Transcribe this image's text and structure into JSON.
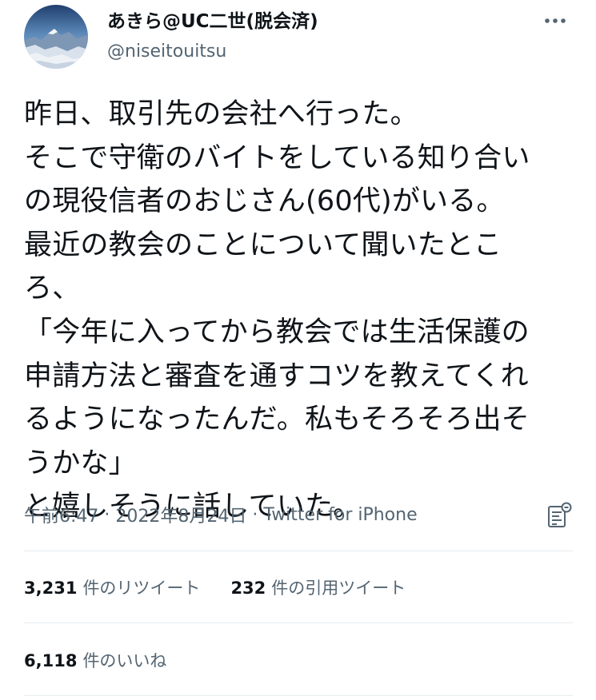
{
  "user": {
    "display_name": "あきら@UC二世(脱会済)",
    "handle": "@niseitouitsu",
    "avatar": "mountain-landscape-avatar"
  },
  "header": {
    "more_icon": "more-horizontal-icon"
  },
  "tweet": {
    "lines": [
      "昨日、取引先の会社へ行った。",
      "そこで守衛のバイトをしている知り合い",
      "の現役信者のおじさん(60代)がいる。",
      "最近の教会のことについて聞いたとこ",
      "ろ、",
      "「今年に入ってから教会では生活保護の",
      "申請方法と審査を通すコツを教えてくれ",
      "るようになったんだ。私もそろそろ出そ",
      "うかな」",
      "と嬉しそうに話していた。"
    ]
  },
  "meta": {
    "time": "午前6:47",
    "separator": "·",
    "date": "2022年8月24日",
    "source": "Twitter for iPhone",
    "analytics_icon": "analytics-icon"
  },
  "stats": {
    "retweets": {
      "count": "3,231",
      "label": "件のリツイート"
    },
    "quotes": {
      "count": "232",
      "label": "件の引用ツイート"
    },
    "likes": {
      "count": "6,118",
      "label": "件のいいね"
    }
  },
  "colors": {
    "text_primary": "#0f1419",
    "text_secondary": "#536471",
    "divider": "#e6ecf0"
  }
}
